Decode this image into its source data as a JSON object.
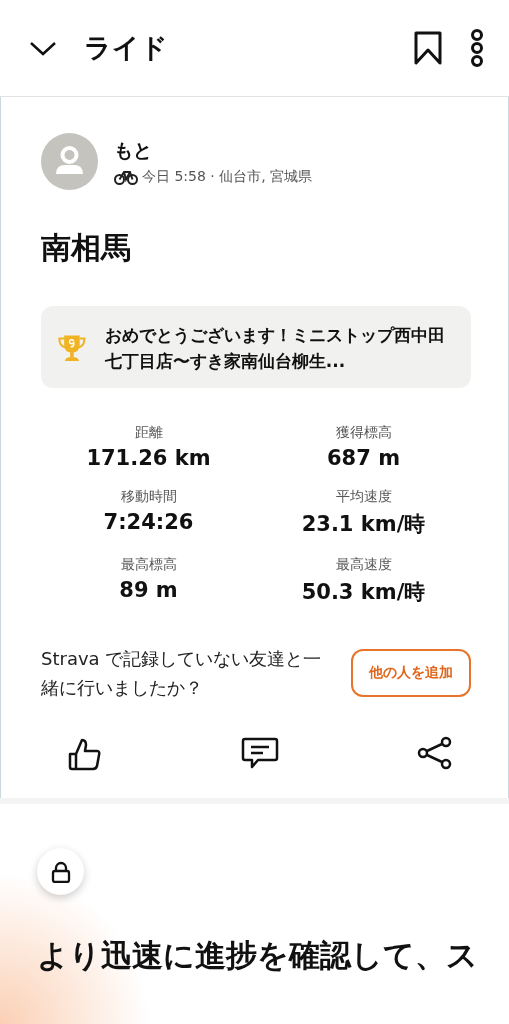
{
  "header": {
    "title": "ライド"
  },
  "activity": {
    "athlete": "もと",
    "meta": "今日 5:58 · 仙台市, 宮城県",
    "title": "南相馬",
    "achievement": "おめでとうございます！ミニストップ西中田七丁目店〜すき家南仙台柳生...",
    "stats": [
      {
        "label": "距離",
        "value": "171.26 km"
      },
      {
        "label": "獲得標高",
        "value": "687 m"
      },
      {
        "label": "移動時間",
        "value": "7:24:26"
      },
      {
        "label": "平均速度",
        "value": "23.1 km/時"
      },
      {
        "label": "最高標高",
        "value": "89 m"
      },
      {
        "label": "最高速度",
        "value": "50.3 km/時"
      }
    ],
    "tag_prompt": "Strava で記録していない友達と一緒に行いましたか？",
    "tag_button": "他の人を追加"
  },
  "promo": {
    "title": "より迅速に進捗を確認して、ス"
  }
}
